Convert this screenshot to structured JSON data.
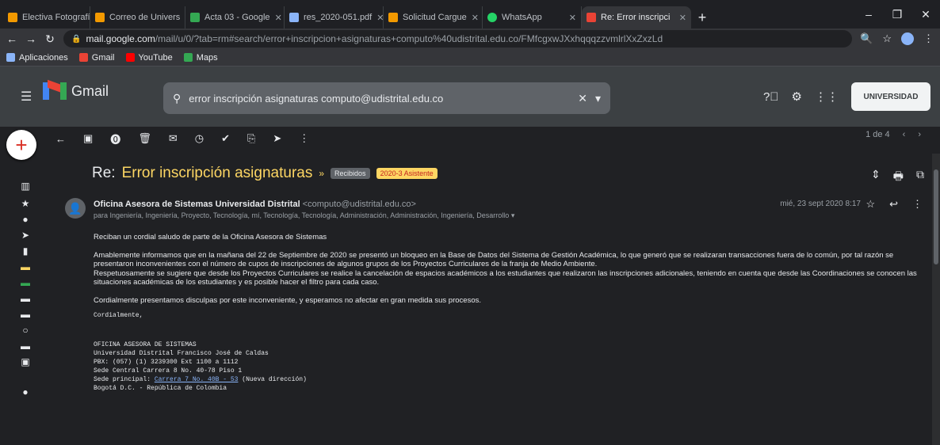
{
  "browser": {
    "tabs": [
      {
        "title": "Electiva Fotografí",
        "color": "#f29900"
      },
      {
        "title": "Correo de Univers",
        "color": "#f29900"
      },
      {
        "title": "Acta 03 - Google",
        "color": "#34a853"
      },
      {
        "title": "res_2020-051.pdf",
        "color": "#8ab4f8"
      },
      {
        "title": "Solicitud Cargue",
        "color": "#f29900"
      },
      {
        "title": "WhatsApp",
        "color": "#25d366"
      },
      {
        "title": "Re: Error inscripci",
        "color": "#ea4335"
      }
    ],
    "new_tab": "+",
    "address_host": "mail.google.com",
    "address_path": "/mail/u/0/?tab=rm#search/error+inscripcion+asignaturas+computo%40udistrital.edu.co/FMfcgxwJXxhqqqzzvmlrlXxZxzLd",
    "bookmarks": [
      {
        "label": "Aplicaciones",
        "color": "#8ab4f8"
      },
      {
        "label": "Gmail",
        "color": "#ea4335"
      },
      {
        "label": "YouTube",
        "color": "#ff0000"
      },
      {
        "label": "Maps",
        "color": "#34a853"
      }
    ]
  },
  "gmail": {
    "logo_text": "Gmail",
    "search_query": "error inscripción asignaturas computo@udistrital.edu.co",
    "pager": "1 de 4",
    "account_label": "UNIVERSIDAD"
  },
  "email": {
    "subject_prefix": "Re:",
    "subject": "Error inscripción asignaturas",
    "labels": [
      "Recibidos",
      "2020-3 Asistente"
    ],
    "sender_name": "Oficina Asesora de Sistemas Universidad Distrital",
    "sender_email": "<computo@udistrital.edu.co>",
    "recipients": "para Ingeniería, Ingeniería, Proyecto, Tecnología, mí, Tecnología, Tecnología, Administración, Administración, Ingeniería, Desarrollo",
    "date": "mié, 23 sept 2020 8:17",
    "greeting": "Reciban un cordial saludo de parte de la Oficina Asesora de Sistemas",
    "paragraph1": "Amablemente informamos que en la mañana del 22 de Septiembre de 2020 se presentó un bloqueo en la Base de Datos del Sistema de Gestión Académica, lo que generó que se realizaran transacciones fuera de lo común, por tal razón se presentaron inconvenientes con el número de cupos de inscripciones de algunos grupos de los Proyectos Curriculares de la franja de Medio Ambiente.",
    "paragraph2": "Respetuosamente se sugiere que desde los Proyectos Curriculares se realice la cancelación de espacios académicos a los estudiantes que realizaron las inscripciones adicionales, teniendo en cuenta que desde las Coordinaciones se conocen las situaciones académicas de los estudiantes y es posible hacer el filtro para cada caso.",
    "paragraph3": "Cordialmente presentamos disculpas por este inconveniente, y esperamos no afectar en gran medida sus procesos.",
    "closing": "Cordialmente,",
    "signature": [
      "OFICINA ASESORA DE SISTEMAS",
      "Universidad Distrital Francisco José de Caldas",
      "PBX: (057) (1) 3239300 Ext 1100 a 1112",
      "Sede Central Carrera 8 No. 40-78 Piso 1"
    ],
    "sig_sede_label": "Sede principal:",
    "sig_sede_link": "Carrera 7 No. 40B - 53",
    "sig_sede_note": "(Nueva dirección)",
    "sig_city": "Bogotá D.C. - República de Colombia"
  }
}
